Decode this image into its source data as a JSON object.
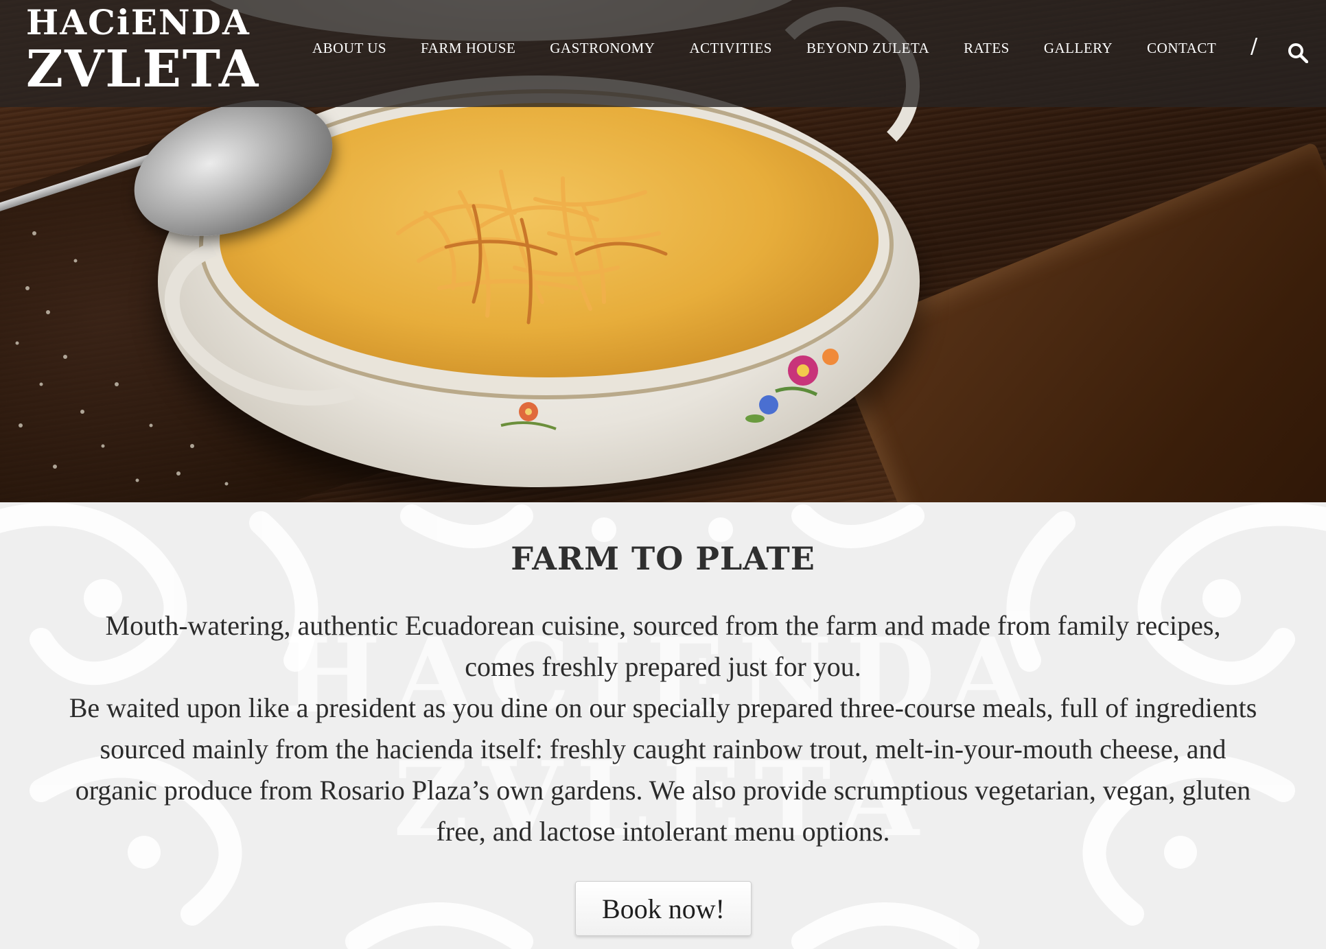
{
  "header": {
    "logo_line1": "HACiENDA",
    "logo_line2": "ZVLETA",
    "nav": [
      {
        "label": "ABOUT US"
      },
      {
        "label": "FARM HOUSE"
      },
      {
        "label": "GASTRONOMY"
      },
      {
        "label": "ACTIVITIES"
      },
      {
        "label": "BEYOND ZULETA"
      },
      {
        "label": "RATES"
      },
      {
        "label": "GALLERY"
      },
      {
        "label": "CONTACT"
      }
    ],
    "separator": "/",
    "search_icon": "search-icon"
  },
  "hero": {
    "image": "soup-tureen-photo"
  },
  "main": {
    "title": "FARM TO PLATE",
    "paragraph1": "Mouth-watering, authentic Ecuadorean cuisine, sourced from the farm and made from family recipes, comes freshly prepared just for you.",
    "paragraph2": "Be waited upon like a president as you dine on our specially prepared three-course meals, full of ingredients sourced mainly from the hacienda itself: freshly caught rainbow trout, melt-in-your-mouth cheese, and organic produce from Rosario Plaza’s own gardens. We also provide scrumptious vegetarian, vegan, gluten free, and lactose intolerant menu options.",
    "button_label": "Book now!",
    "watermark_line1": "HACIENDA",
    "watermark_line2": "ZVLETA"
  },
  "colors": {
    "header_bg": "#282422",
    "content_bg": "#efefef",
    "text": "#2b2b2b"
  }
}
